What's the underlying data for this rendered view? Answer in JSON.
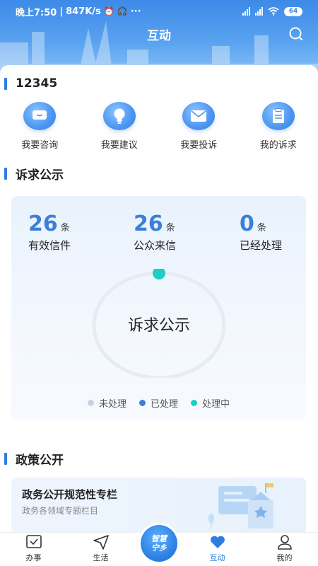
{
  "status_bar": {
    "time": "晚上7:50",
    "speed": "847K/s",
    "battery": "64"
  },
  "header": {
    "title": "互动"
  },
  "section_12345": {
    "title": "12345",
    "items": [
      {
        "label": "我要咨询",
        "icon": "chat-icon"
      },
      {
        "label": "我要建议",
        "icon": "lightbulb-icon"
      },
      {
        "label": "我要投诉",
        "icon": "envelope-icon"
      },
      {
        "label": "我的诉求",
        "icon": "clipboard-icon"
      }
    ]
  },
  "section_appeals": {
    "title": "诉求公示",
    "stats": [
      {
        "value": "26",
        "unit": "条",
        "label": "有效信件"
      },
      {
        "value": "26",
        "unit": "条",
        "label": "公众来信"
      },
      {
        "value": "0",
        "unit": "条",
        "label": "已经处理"
      }
    ],
    "ring_label": "诉求公示",
    "legend": [
      {
        "label": "未处理",
        "color": "#c7d3e3"
      },
      {
        "label": "已处理",
        "color": "#3b7fd8"
      },
      {
        "label": "处理中",
        "color": "#1ccfc0"
      }
    ]
  },
  "section_policy": {
    "title": "政策公开",
    "card": {
      "title": "政务公开规范性专栏",
      "subtitle": "政务各领域专题栏目"
    }
  },
  "tabbar": {
    "items": [
      {
        "label": "办事",
        "icon": "checklist-icon"
      },
      {
        "label": "生活",
        "icon": "send-icon"
      },
      {
        "label": "互动",
        "icon": "heart-icon",
        "active": true
      },
      {
        "label": "我的",
        "icon": "user-icon"
      }
    ],
    "center_logo_line1": "智慧",
    "center_logo_line2": "宁乡"
  },
  "colors": {
    "accent": "#2f7de1",
    "stat_number": "#3b7fd8",
    "header_top": "#3d8ae8"
  }
}
